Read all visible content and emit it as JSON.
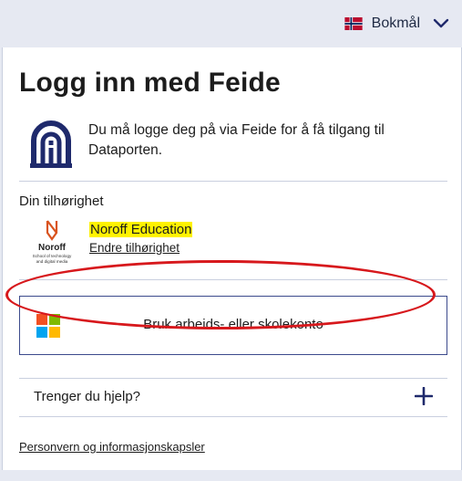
{
  "language": {
    "selected": "Bokmål",
    "flag_icon": "norway-flag-icon",
    "dropdown_icon": "chevron-down-icon"
  },
  "login": {
    "title": "Logg inn med Feide",
    "intro": "Du må logge deg på via Feide for å få tilgang til Dataporten.",
    "logo_icon": "feide-logo-icon"
  },
  "affiliation": {
    "label": "Din tilhørighet",
    "org_name": "Noroff Education",
    "change_link": "Endre tilhørighet",
    "org_logo": {
      "wordmark": "Noroff",
      "tagline_line1": "School of technology",
      "tagline_line2": "and digital media"
    }
  },
  "microsoft_button": {
    "label": "Bruk arbeids- eller skolekonto",
    "icon": "microsoft-logo-icon"
  },
  "help": {
    "label": "Trenger du hjelp?",
    "icon": "plus-icon"
  },
  "footer": {
    "privacy_link": "Personvern og informasjonskapsler"
  },
  "colors": {
    "background": "#e6e9f2",
    "card": "#ffffff",
    "accent": "#1f2a6c",
    "border": "#c9cfdf",
    "highlight": "#fff200",
    "annotation_red": "#d7181c"
  }
}
